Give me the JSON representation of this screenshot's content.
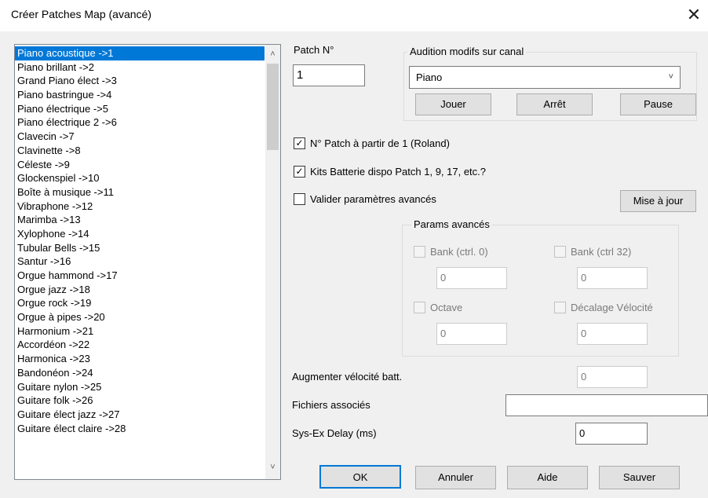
{
  "window": {
    "title": "Créer Patches Map (avancé)",
    "close_glyph": "✕"
  },
  "patch_list": {
    "items": [
      "Piano acoustique  ->1",
      "Piano brillant  ->2",
      "Grand Piano élect  ->3",
      "Piano bastringue  ->4",
      "Piano électrique  ->5",
      "Piano électrique 2  ->6",
      "Clavecin  ->7",
      "Clavinette  ->8",
      "Céleste  ->9",
      "Glockenspiel  ->10",
      "Boîte à musique  ->11",
      "Vibraphone  ->12",
      "Marimba  ->13",
      "Xylophone  ->14",
      "Tubular Bells  ->15",
      "Santur  ->16",
      "Orgue hammond  ->17",
      "Orgue jazz  ->18",
      "Orgue rock  ->19",
      "Orgue à pipes  ->20",
      "Harmonium  ->21",
      "Accordéon  ->22",
      "Harmonica  ->23",
      "Bandonéon  ->24",
      "Guitare nylon  ->25",
      "Guitare folk  ->26",
      "Guitare élect jazz  ->27",
      "Guitare élect claire  ->28"
    ],
    "selected_index": 0,
    "scroll_up_glyph": "˄",
    "scroll_down_glyph": "˅"
  },
  "patch_no": {
    "label": "Patch N°",
    "value": "1"
  },
  "audition": {
    "group_label": "Audition modifs sur canal",
    "selected": "Piano",
    "dropdown_glyph": "˅",
    "play_button": "Jouer",
    "stop_button": "Arrêt",
    "pause_button": "Pause"
  },
  "options": {
    "patch_from_1": {
      "label": "N° Patch à partir de 1 (Roland)",
      "checked": true
    },
    "drum_kits": {
      "label": "Kits Batterie dispo Patch 1, 9, 17, etc.?",
      "checked": true
    },
    "advanced": {
      "label": "Valider paramètres avancés",
      "checked": false
    },
    "check_glyph": "✓",
    "update_button": "Mise à jour"
  },
  "advanced_params": {
    "group_label": "Params avancés",
    "bank_ctrl0": {
      "label": "Bank (ctrl. 0)",
      "value": "0"
    },
    "bank_ctrl32": {
      "label": "Bank (ctrl 32)",
      "value": "0"
    },
    "octave": {
      "label": "Octave",
      "value": "0"
    },
    "velocity_offset": {
      "label": "Décalage Vélocité",
      "value": "0"
    }
  },
  "fields": {
    "drum_velocity": {
      "label": "Augmenter vélocité batt.",
      "value": "0"
    },
    "associated_files": {
      "label": "Fichiers associés",
      "value": ""
    },
    "sysex_delay": {
      "label": "Sys-Ex Delay (ms)",
      "value": "0"
    }
  },
  "buttons": {
    "ok": "OK",
    "cancel": "Annuler",
    "help": "Aide",
    "save": "Sauver"
  }
}
